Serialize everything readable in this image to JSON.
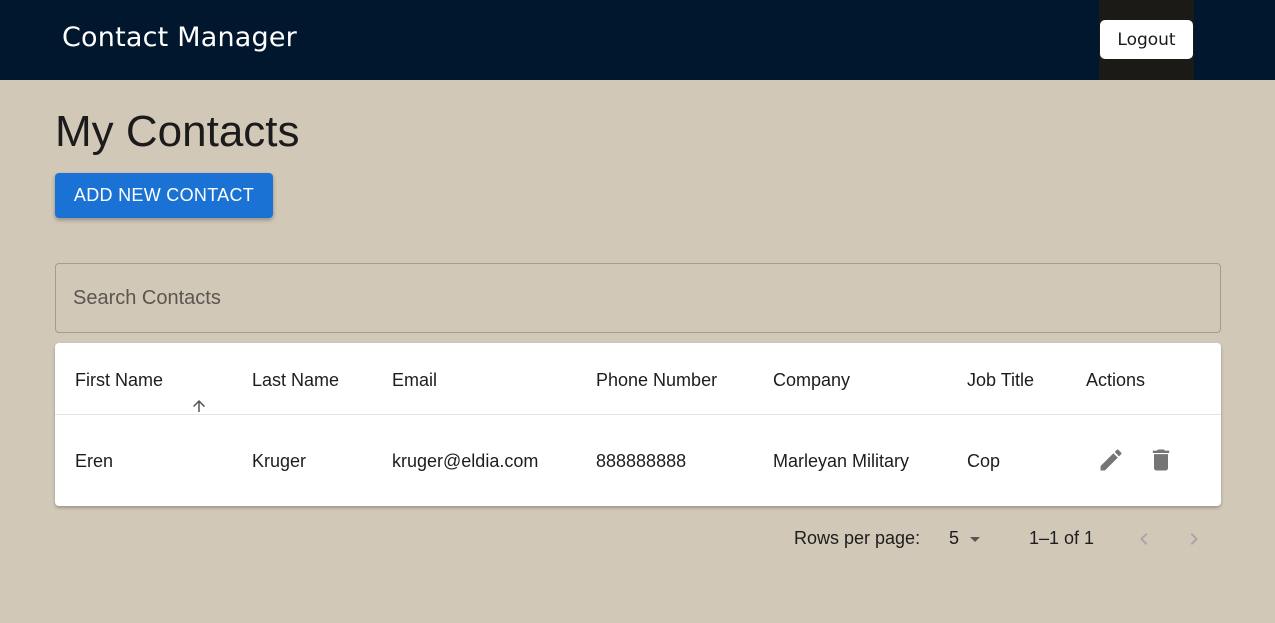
{
  "header": {
    "title": "Contact Manager",
    "logout_label": "Logout"
  },
  "main": {
    "title": "My Contacts",
    "add_button_label": "ADD NEW CONTACT",
    "search": {
      "placeholder": "Search Contacts",
      "value": ""
    }
  },
  "table": {
    "columns": [
      "First Name",
      "Last Name",
      "Email",
      "Phone Number",
      "Company",
      "Job Title",
      "Actions"
    ],
    "sort": {
      "column": "First Name",
      "direction": "ascending",
      "icon": "arrow-up-icon"
    },
    "rows": [
      {
        "first_name": "Eren",
        "last_name": "Kruger",
        "email": "kruger@eldia.com",
        "phone": "888888888",
        "company": "Marleyan Military",
        "job_title": "Cop"
      }
    ],
    "action_icons": [
      "edit-pencil-icon",
      "delete-trash-icon"
    ]
  },
  "pagination": {
    "rows_per_page_label": "Rows per page:",
    "rows_per_page": "5",
    "range": "1–1 of 1",
    "prev_enabled": false,
    "next_enabled": false
  },
  "colors": {
    "header_bg": "#01172e",
    "page_bg": "#d2c8b8",
    "primary": "#1a73d4",
    "icon": "#757575",
    "icon_disabled": "#a8a8a8"
  }
}
